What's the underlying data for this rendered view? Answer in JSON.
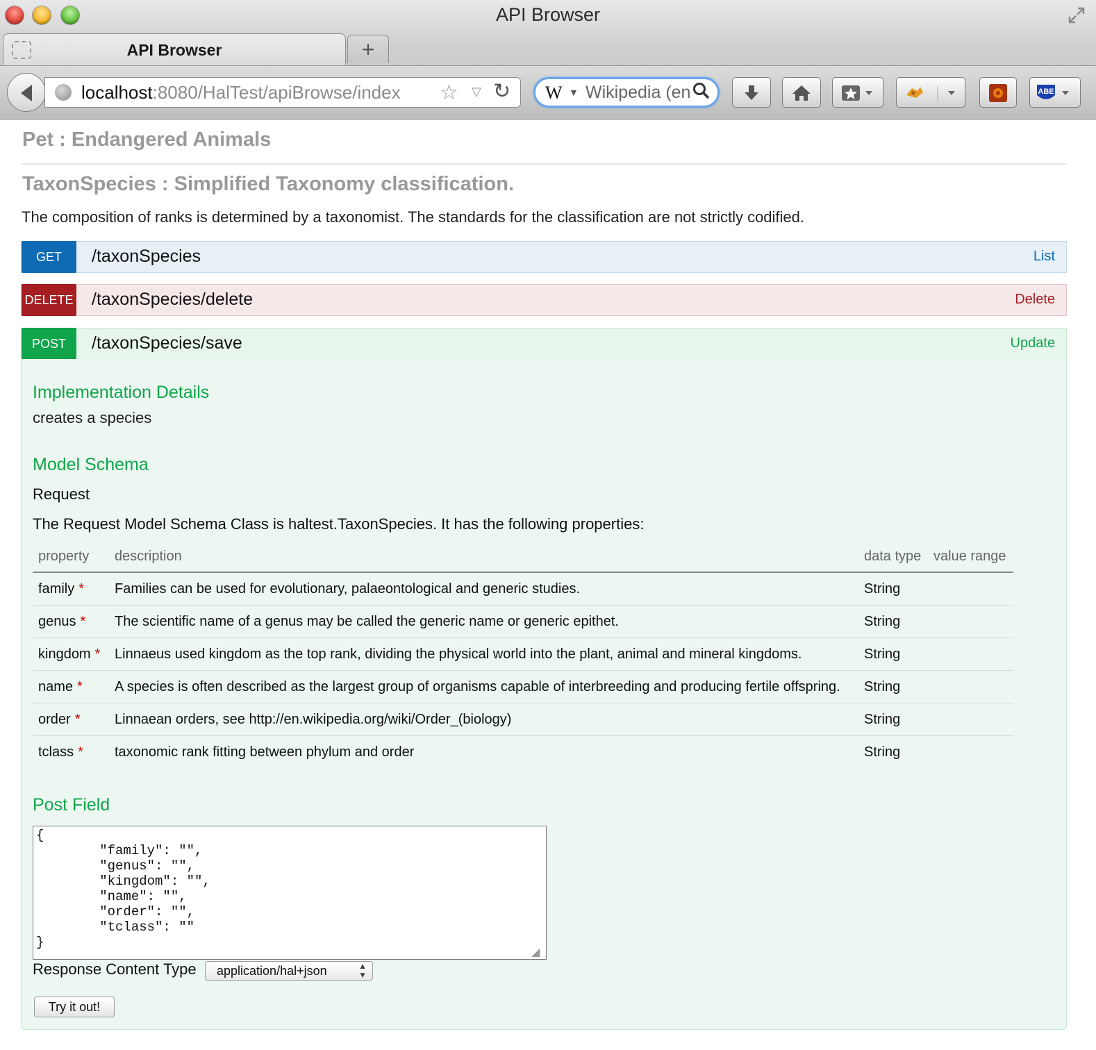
{
  "window": {
    "title": "API Browser"
  },
  "tab": {
    "title": "API Browser",
    "new_tab_label": "+"
  },
  "toolbar": {
    "url_host": "localhost",
    "url_rest": ":8080/HalTest/apiBrowse/index",
    "search_engine_icon": "W",
    "search_text": "Wikipedia (en",
    "icons": {
      "back": "back-arrow-icon",
      "site": "globe-icon",
      "bookmark_star": "star-icon",
      "reload": "reload-icon",
      "search": "magnifier-icon",
      "download": "download-arrow-icon",
      "home": "home-icon",
      "bookmarks": "bookmarks-star-icon",
      "extensions": [
        "puzzle-extension-icon",
        "red-extension-icon",
        "abe-extension-icon"
      ]
    }
  },
  "page": {
    "resource_title": "Pet : Endangered Animals",
    "species_title": "TaxonSpecies : Simplified Taxonomy classification.",
    "species_description": "The composition of ranks is determined by a taxonomist. The standards for the classification are not strictly codified.",
    "operations": [
      {
        "method": "GET",
        "path": "/taxonSpecies",
        "summary": "List",
        "color": "#0f6ab4"
      },
      {
        "method": "DELETE",
        "path": "/taxonSpecies/delete",
        "summary": "Delete",
        "color": "#a41e22"
      },
      {
        "method": "POST",
        "path": "/taxonSpecies/save",
        "summary": "Update",
        "color": "#10a54a"
      }
    ],
    "post_details": {
      "implementation_heading": "Implementation Details",
      "implementation_notes": "creates a species",
      "model_heading": "Model Schema",
      "request_label": "Request",
      "model_description": "The Request Model Schema Class is haltest.TaxonSpecies. It has the following properties:",
      "columns": [
        "property",
        "description",
        "data type",
        "value range"
      ],
      "properties": [
        {
          "name": "family",
          "required": "*",
          "description": "Families can be used for evolutionary, palaeontological and generic studies.",
          "type": "String",
          "range": ""
        },
        {
          "name": "genus",
          "required": "*",
          "description": "The scientific name of a genus may be called the generic name or generic epithet.",
          "type": "String",
          "range": ""
        },
        {
          "name": "kingdom",
          "required": "*",
          "description": "Linnaeus used kingdom as the top rank, dividing the physical world into the plant, animal and mineral kingdoms.",
          "type": "String",
          "range": ""
        },
        {
          "name": "name",
          "required": "*",
          "description": "A species is often described as the largest group of organisms capable of interbreeding and producing fertile offspring.",
          "type": "String",
          "range": ""
        },
        {
          "name": "order",
          "required": "*",
          "description": "Linnaean orders, see http://en.wikipedia.org/wiki/Order_(biology)",
          "type": "String",
          "range": ""
        },
        {
          "name": "tclass",
          "required": "*",
          "description": "taxonomic rank fitting between phylum and order",
          "type": "String",
          "range": ""
        }
      ],
      "post_field_heading": "Post Field",
      "post_field_value": "{\n\t\"family\": \"\",\n\t\"genus\": \"\",\n\t\"kingdom\": \"\",\n\t\"name\": \"\",\n\t\"order\": \"\",\n\t\"tclass\": \"\"\n}",
      "response_content_type_label": "Response Content Type",
      "response_content_type_value": "application/hal+json",
      "try_button_label": "Try it out!"
    }
  }
}
